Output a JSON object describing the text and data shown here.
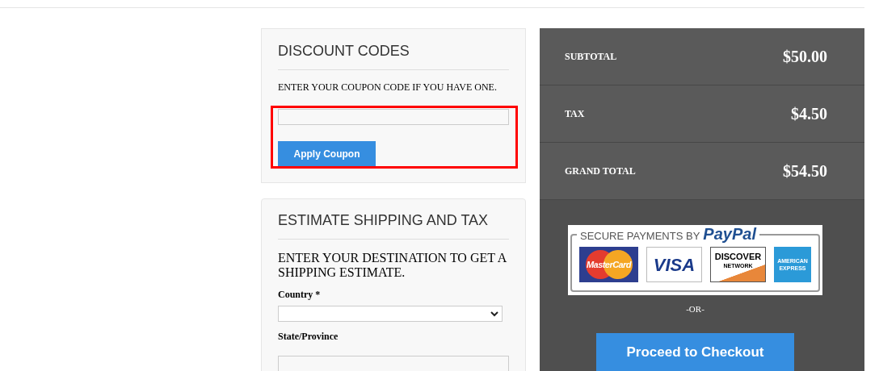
{
  "discount": {
    "title": "DISCOUNT CODES",
    "hint": "ENTER YOUR COUPON CODE IF YOU HAVE ONE.",
    "button": "Apply Coupon",
    "highlighted": true
  },
  "shipping": {
    "title": "ESTIMATE SHIPPING AND TAX",
    "hint": "ENTER YOUR DESTINATION TO GET A SHIPPING ESTIMATE.",
    "fields": [
      {
        "kind": "select",
        "label": "Country *"
      },
      {
        "kind": "text",
        "label": "State/Province"
      }
    ]
  },
  "totals": [
    {
      "label": "SUBTOTAL",
      "value": "$50.00"
    },
    {
      "label": "TAX",
      "value": "$4.50"
    },
    {
      "label": "GRAND TOTAL",
      "value": "$54.50"
    }
  ],
  "badge": {
    "caption": "SECURE PAYMENTS BY",
    "brand": "PayPal",
    "cards": [
      {
        "kind": "mastercard",
        "label": "MasterCard"
      },
      {
        "kind": "visa",
        "label": "VISA"
      },
      {
        "kind": "discover",
        "label": "DISCOVER",
        "sub": "NETWORK"
      },
      {
        "kind": "amex",
        "label": "AMERICAN EXPRESS"
      }
    ]
  },
  "separator": "-OR-",
  "checkout": "Proceed to Checkout"
}
